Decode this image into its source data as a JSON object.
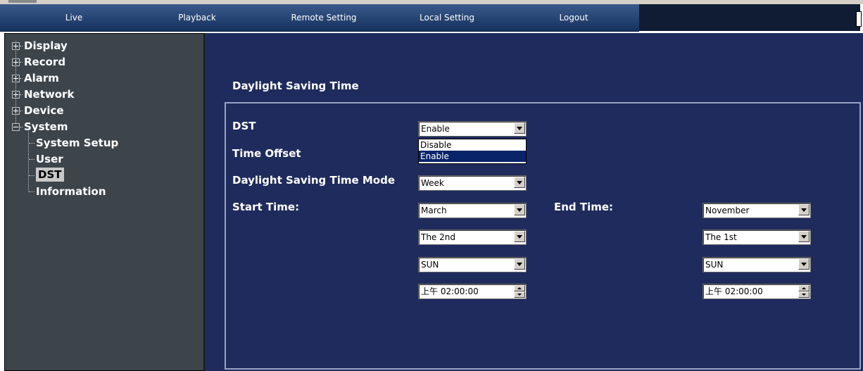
{
  "nav": {
    "items": [
      "Live",
      "Playback",
      "Remote Setting",
      "Local Setting",
      "Logout"
    ]
  },
  "sidebar": {
    "items": [
      {
        "label": "Display"
      },
      {
        "label": "Record"
      },
      {
        "label": "Alarm"
      },
      {
        "label": "Network"
      },
      {
        "label": "Device"
      },
      {
        "label": "System"
      }
    ],
    "system_children": [
      "System Setup",
      "User",
      "DST",
      "Information"
    ],
    "selected": "DST"
  },
  "content": {
    "section_title": "Daylight Saving Time",
    "dst_label": "DST",
    "dst_value": "Enable",
    "dst_options": [
      "Disable",
      "Enable"
    ],
    "time_offset_label": "Time Offset",
    "mode_label": "Daylight Saving Time Mode",
    "mode_value": "Week",
    "start_label": "Start Time:",
    "end_label": "End Time:",
    "start": {
      "month": "March",
      "week": "The 2nd",
      "day": "SUN",
      "time": "上午 02:00:00"
    },
    "end": {
      "month": "November",
      "week": "The 1st",
      "day": "SUN",
      "time": "上午 02:00:00"
    }
  },
  "colors": {
    "nav_bg": "#16315e",
    "sidebar_bg": "#3d454b",
    "main_bg": "#1f2b5c",
    "highlight": "#0a246a"
  }
}
